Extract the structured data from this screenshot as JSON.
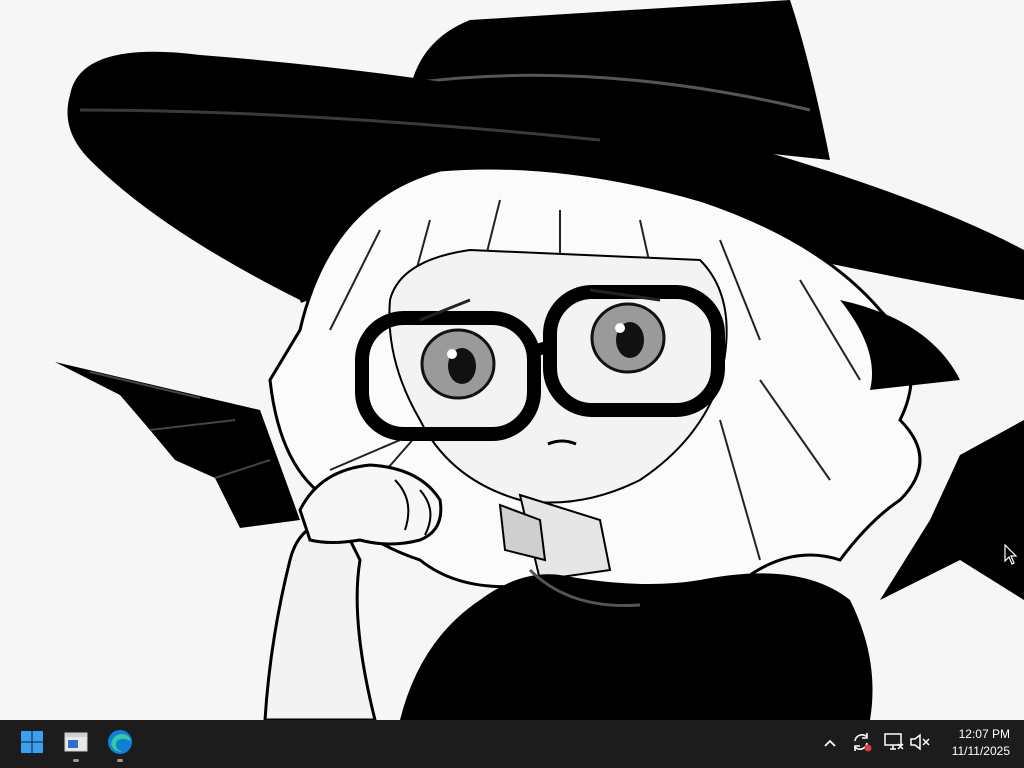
{
  "desktop": {
    "wallpaper": {
      "icon": "anime-witch-girl-illustration",
      "colors": {
        "ink": "#000000",
        "paper": "#f6f6f6",
        "shade": "#cfcfcf"
      }
    }
  },
  "taskbar": {
    "background": "#1c1c1c",
    "pinned": [
      {
        "name": "start-button",
        "icon": "windows-logo-icon",
        "running": false
      },
      {
        "name": "taskbar-app-window",
        "icon": "app-window-icon",
        "running": true
      },
      {
        "name": "taskbar-app-edge",
        "icon": "edge-browser-icon",
        "running": true
      }
    ],
    "tray": [
      {
        "name": "show-hidden-icons-button",
        "icon": "chevron-up-icon"
      },
      {
        "name": "sync-status-icon",
        "icon": "sync-alert-icon"
      },
      {
        "name": "network-icon",
        "icon": "network-disconnected-icon"
      },
      {
        "name": "volume-icon",
        "icon": "volume-muted-icon"
      }
    ],
    "clock": {
      "time": "12:07 PM",
      "date": "11/11/2025"
    }
  }
}
